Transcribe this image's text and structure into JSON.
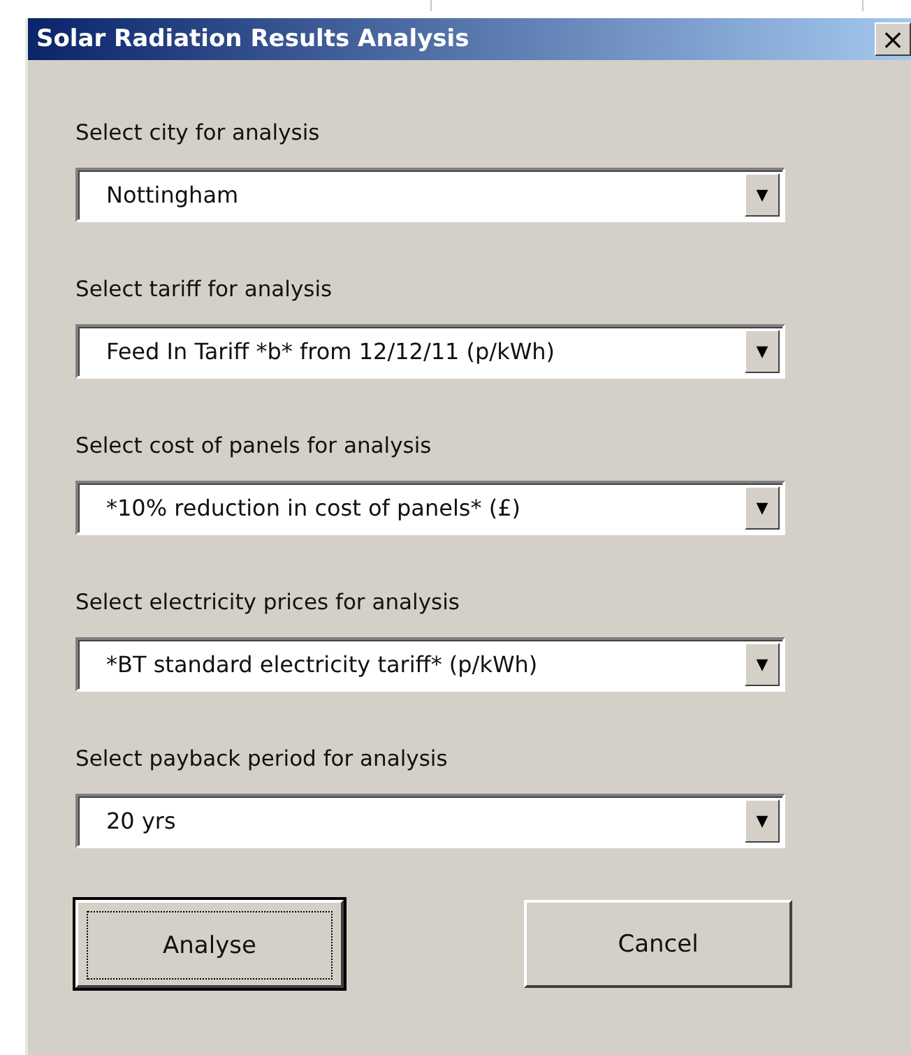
{
  "window": {
    "title": "Solar Radiation Results Analysis",
    "close": "×"
  },
  "fields": [
    {
      "label": "Select city for analysis",
      "value": "Nottingham",
      "arrow": "▼"
    },
    {
      "label": "Select tariff for analysis",
      "value": "Feed In Tariff *b* from 12/12/11 (p/kWh)",
      "arrow": "▼"
    },
    {
      "label": "Select cost of panels for analysis",
      "value": "*10% reduction in cost of panels* (£)",
      "arrow": "▼"
    },
    {
      "label": "Select electricity prices for analysis",
      "value": "*BT standard electricity tariff* (p/kWh)",
      "arrow": "▼"
    },
    {
      "label": "Select payback period for analysis",
      "value": "20 yrs",
      "arrow": "▼"
    }
  ],
  "buttons": [
    {
      "label": "Analyse",
      "focused": true
    },
    {
      "label": "Cancel",
      "focused": false
    }
  ]
}
